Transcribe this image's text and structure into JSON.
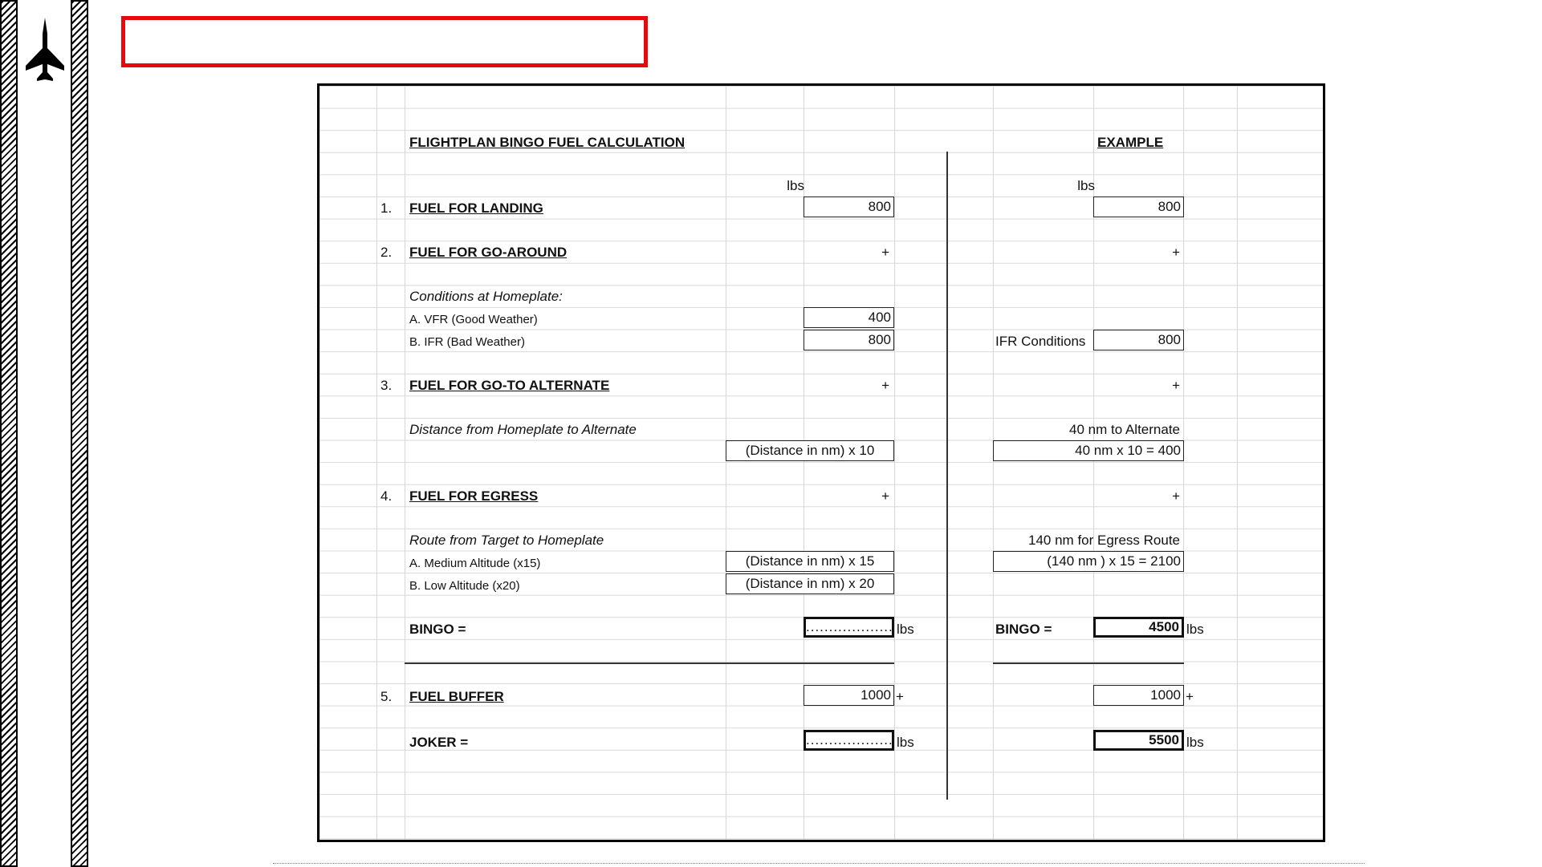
{
  "sheet": {
    "title": "FLIGHTPLAN BINGO FUEL CALCULATION",
    "example_title": "EXAMPLE",
    "unit": "lbs",
    "plus": "+",
    "items": {
      "landing": {
        "num": "1.",
        "label": "FUEL FOR LANDING",
        "value": "800",
        "example_value": "800"
      },
      "go_around": {
        "num": "2.",
        "label": "FUEL FOR GO-AROUND",
        "conditions_label": "Conditions at Homeplate:",
        "vfr_label": "A. VFR (Good Weather)",
        "vfr_value": "400",
        "ifr_label": "B. IFR (Bad Weather)",
        "ifr_value": "800",
        "example_label": "IFR Conditions",
        "example_value": "800"
      },
      "alternate": {
        "num": "3.",
        "label": "FUEL FOR GO-TO ALTERNATE",
        "sub_label": "Distance from Homeplate to Alternate",
        "formula": "(Distance in nm) x 10",
        "example_note": "40 nm to Alternate",
        "example_formula": "40 nm x 10 = 400"
      },
      "egress": {
        "num": "4.",
        "label": "FUEL FOR EGRESS",
        "sub_label": "Route from Target to Homeplate",
        "medium_label": "A. Medium Altitude (x15)",
        "medium_formula": "(Distance in nm) x 15",
        "low_label": "B. Low Altitude (x20)",
        "low_formula": "(Distance in nm) x 20",
        "example_note": "140 nm for Egress Route",
        "example_formula": "(140 nm ) x 15  = 2100"
      },
      "bingo": {
        "label": "BINGO =",
        "value": "...................",
        "example_label": "BINGO =",
        "example_value": "4500"
      },
      "buffer": {
        "num": "5.",
        "label": "FUEL BUFFER",
        "value": "1000",
        "example_value": "1000"
      },
      "joker": {
        "label": "JOKER =",
        "value": "...................",
        "example_value": "5500"
      }
    }
  },
  "icons": {
    "jet": "fighter-jet-icon"
  }
}
